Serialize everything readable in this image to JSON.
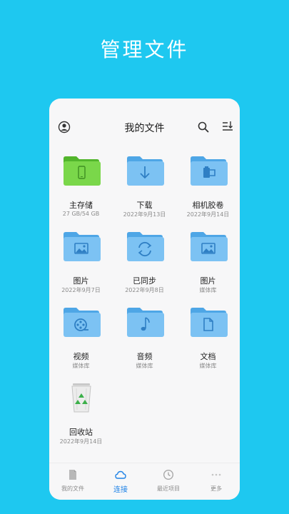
{
  "hero": {
    "title": "管理文件"
  },
  "header": {
    "title": "我的文件"
  },
  "tiles": [
    {
      "name": "主存储",
      "sub": "27 GB/54 GB"
    },
    {
      "name": "下载",
      "sub": "2022年9月13日"
    },
    {
      "name": "相机胶卷",
      "sub": "2022年9月14日"
    },
    {
      "name": "图片",
      "sub": "2022年9月7日"
    },
    {
      "name": "已同步",
      "sub": "2022年9月8日"
    },
    {
      "name": "图片",
      "sub": "媒体库"
    },
    {
      "name": "视频",
      "sub": "媒体库"
    },
    {
      "name": "音频",
      "sub": "媒体库"
    },
    {
      "name": "文档",
      "sub": "媒体库"
    },
    {
      "name": "回收站",
      "sub": "2022年9月14日"
    }
  ],
  "nav": [
    {
      "label": "我的文件"
    },
    {
      "label": "连接"
    },
    {
      "label": "最近项目"
    },
    {
      "label": "更多"
    }
  ],
  "colors": {
    "background": "#1ec8f0",
    "folder": "#7cc2f3",
    "folder_tab": "#4ea6e6",
    "storage_folder": "#7ad74a",
    "active_nav": "#1e82e6"
  },
  "icons": [
    "account-icon",
    "search-icon",
    "sort-icon",
    "phone-icon",
    "download-arrow-icon",
    "camera-roll-icon",
    "image-icon",
    "sync-icon",
    "film-reel-icon",
    "music-note-icon",
    "document-icon",
    "recycle-bin-icon",
    "file-icon",
    "cloud-icon",
    "clock-icon",
    "more-dots-icon"
  ]
}
